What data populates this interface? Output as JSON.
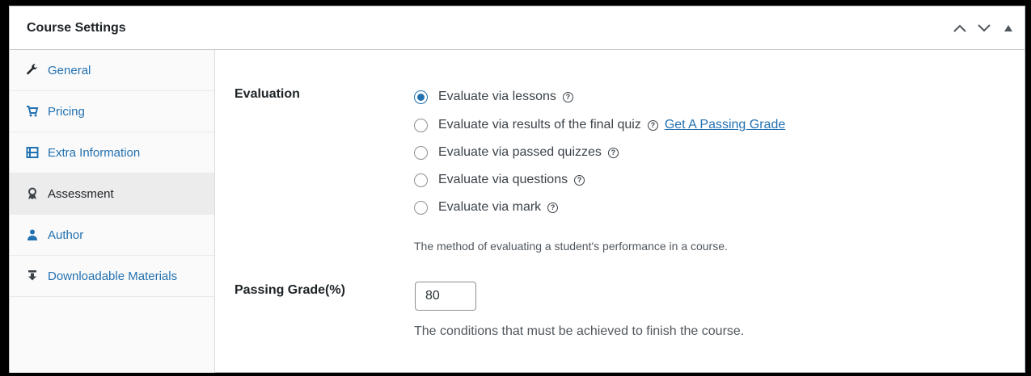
{
  "panel": {
    "title": "Course Settings"
  },
  "tabs": [
    {
      "label": "General",
      "icon": "wrench-icon"
    },
    {
      "label": "Pricing",
      "icon": "cart-icon"
    },
    {
      "label": "Extra Information",
      "icon": "list-icon"
    },
    {
      "label": "Assessment",
      "icon": "award-icon",
      "active": true
    },
    {
      "label": "Author",
      "icon": "user-icon"
    },
    {
      "label": "Downloadable Materials",
      "icon": "download-icon"
    }
  ],
  "evaluation": {
    "label": "Evaluation",
    "options": [
      {
        "label": "Evaluate via lessons",
        "checked": true
      },
      {
        "label": "Evaluate via results of the final quiz",
        "checked": false,
        "link": "Get A Passing Grade"
      },
      {
        "label": "Evaluate via passed quizzes",
        "checked": false
      },
      {
        "label": "Evaluate via questions",
        "checked": false
      },
      {
        "label": "Evaluate via mark",
        "checked": false
      }
    ],
    "description": "The method of evaluating a student's performance in a course."
  },
  "passing_grade": {
    "label": "Passing Grade(%)",
    "value": "80",
    "description": "The conditions that must be achieved to finish the course."
  },
  "colors": {
    "accent": "#2271b1",
    "text": "#1d2327",
    "muted": "#50575e"
  }
}
